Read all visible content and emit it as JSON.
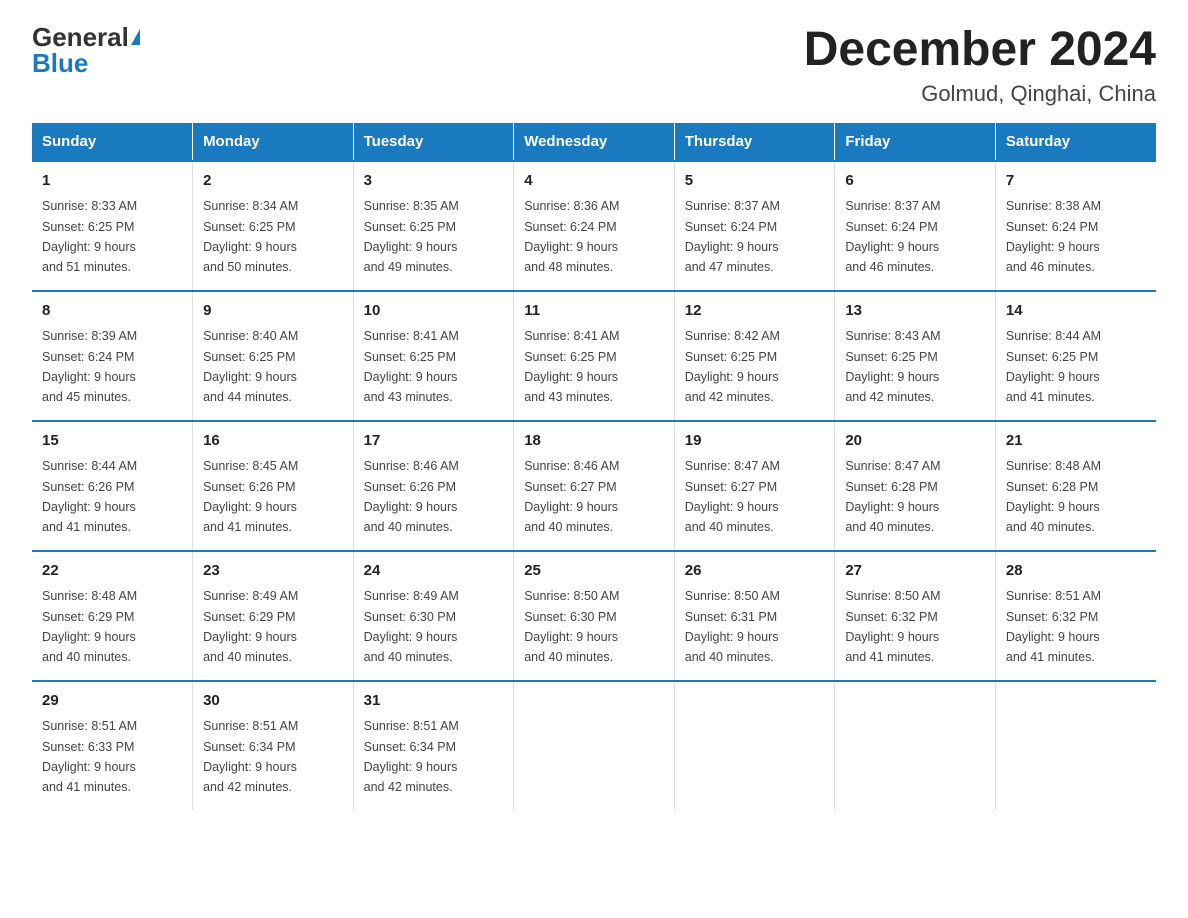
{
  "header": {
    "logo_general": "General",
    "logo_blue": "Blue",
    "title": "December 2024",
    "subtitle": "Golmud, Qinghai, China"
  },
  "days_of_week": [
    "Sunday",
    "Monday",
    "Tuesday",
    "Wednesday",
    "Thursday",
    "Friday",
    "Saturday"
  ],
  "weeks": [
    [
      {
        "num": "1",
        "sunrise": "8:33 AM",
        "sunset": "6:25 PM",
        "daylight": "9 hours and 51 minutes."
      },
      {
        "num": "2",
        "sunrise": "8:34 AM",
        "sunset": "6:25 PM",
        "daylight": "9 hours and 50 minutes."
      },
      {
        "num": "3",
        "sunrise": "8:35 AM",
        "sunset": "6:25 PM",
        "daylight": "9 hours and 49 minutes."
      },
      {
        "num": "4",
        "sunrise": "8:36 AM",
        "sunset": "6:24 PM",
        "daylight": "9 hours and 48 minutes."
      },
      {
        "num": "5",
        "sunrise": "8:37 AM",
        "sunset": "6:24 PM",
        "daylight": "9 hours and 47 minutes."
      },
      {
        "num": "6",
        "sunrise": "8:37 AM",
        "sunset": "6:24 PM",
        "daylight": "9 hours and 46 minutes."
      },
      {
        "num": "7",
        "sunrise": "8:38 AM",
        "sunset": "6:24 PM",
        "daylight": "9 hours and 46 minutes."
      }
    ],
    [
      {
        "num": "8",
        "sunrise": "8:39 AM",
        "sunset": "6:24 PM",
        "daylight": "9 hours and 45 minutes."
      },
      {
        "num": "9",
        "sunrise": "8:40 AM",
        "sunset": "6:25 PM",
        "daylight": "9 hours and 44 minutes."
      },
      {
        "num": "10",
        "sunrise": "8:41 AM",
        "sunset": "6:25 PM",
        "daylight": "9 hours and 43 minutes."
      },
      {
        "num": "11",
        "sunrise": "8:41 AM",
        "sunset": "6:25 PM",
        "daylight": "9 hours and 43 minutes."
      },
      {
        "num": "12",
        "sunrise": "8:42 AM",
        "sunset": "6:25 PM",
        "daylight": "9 hours and 42 minutes."
      },
      {
        "num": "13",
        "sunrise": "8:43 AM",
        "sunset": "6:25 PM",
        "daylight": "9 hours and 42 minutes."
      },
      {
        "num": "14",
        "sunrise": "8:44 AM",
        "sunset": "6:25 PM",
        "daylight": "9 hours and 41 minutes."
      }
    ],
    [
      {
        "num": "15",
        "sunrise": "8:44 AM",
        "sunset": "6:26 PM",
        "daylight": "9 hours and 41 minutes."
      },
      {
        "num": "16",
        "sunrise": "8:45 AM",
        "sunset": "6:26 PM",
        "daylight": "9 hours and 41 minutes."
      },
      {
        "num": "17",
        "sunrise": "8:46 AM",
        "sunset": "6:26 PM",
        "daylight": "9 hours and 40 minutes."
      },
      {
        "num": "18",
        "sunrise": "8:46 AM",
        "sunset": "6:27 PM",
        "daylight": "9 hours and 40 minutes."
      },
      {
        "num": "19",
        "sunrise": "8:47 AM",
        "sunset": "6:27 PM",
        "daylight": "9 hours and 40 minutes."
      },
      {
        "num": "20",
        "sunrise": "8:47 AM",
        "sunset": "6:28 PM",
        "daylight": "9 hours and 40 minutes."
      },
      {
        "num": "21",
        "sunrise": "8:48 AM",
        "sunset": "6:28 PM",
        "daylight": "9 hours and 40 minutes."
      }
    ],
    [
      {
        "num": "22",
        "sunrise": "8:48 AM",
        "sunset": "6:29 PM",
        "daylight": "9 hours and 40 minutes."
      },
      {
        "num": "23",
        "sunrise": "8:49 AM",
        "sunset": "6:29 PM",
        "daylight": "9 hours and 40 minutes."
      },
      {
        "num": "24",
        "sunrise": "8:49 AM",
        "sunset": "6:30 PM",
        "daylight": "9 hours and 40 minutes."
      },
      {
        "num": "25",
        "sunrise": "8:50 AM",
        "sunset": "6:30 PM",
        "daylight": "9 hours and 40 minutes."
      },
      {
        "num": "26",
        "sunrise": "8:50 AM",
        "sunset": "6:31 PM",
        "daylight": "9 hours and 40 minutes."
      },
      {
        "num": "27",
        "sunrise": "8:50 AM",
        "sunset": "6:32 PM",
        "daylight": "9 hours and 41 minutes."
      },
      {
        "num": "28",
        "sunrise": "8:51 AM",
        "sunset": "6:32 PM",
        "daylight": "9 hours and 41 minutes."
      }
    ],
    [
      {
        "num": "29",
        "sunrise": "8:51 AM",
        "sunset": "6:33 PM",
        "daylight": "9 hours and 41 minutes."
      },
      {
        "num": "30",
        "sunrise": "8:51 AM",
        "sunset": "6:34 PM",
        "daylight": "9 hours and 42 minutes."
      },
      {
        "num": "31",
        "sunrise": "8:51 AM",
        "sunset": "6:34 PM",
        "daylight": "9 hours and 42 minutes."
      },
      null,
      null,
      null,
      null
    ]
  ],
  "labels": {
    "sunrise": "Sunrise:",
    "sunset": "Sunset:",
    "daylight": "Daylight:"
  }
}
